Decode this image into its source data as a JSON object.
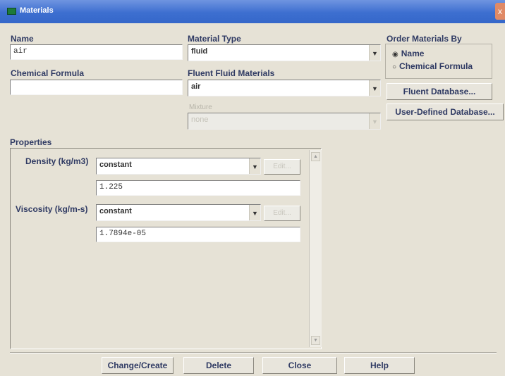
{
  "window": {
    "title": "Materials",
    "close_glyph": "x"
  },
  "name": {
    "label": "Name",
    "value": "air"
  },
  "chemical_formula": {
    "label": "Chemical Formula",
    "value": ""
  },
  "material_type": {
    "label": "Material Type",
    "selected": "fluid"
  },
  "fluent_fluid_materials": {
    "label": "Fluent Fluid Materials",
    "selected": "air"
  },
  "mixture": {
    "label": "Mixture",
    "selected": "none",
    "enabled": false
  },
  "order_by": {
    "label": "Order Materials By",
    "options": [
      {
        "label": "Name",
        "selected": true
      },
      {
        "label": "Chemical Formula",
        "selected": false
      }
    ]
  },
  "buttons": {
    "fluent_database": "Fluent Database...",
    "user_defined_database": "User-Defined Database..."
  },
  "properties": {
    "label": "Properties",
    "density": {
      "label": "Density (kg/m3)",
      "method": "constant",
      "edit_label": "Edit...",
      "value": "1.225"
    },
    "viscosity": {
      "label": "Viscosity (kg/m-s)",
      "method": "constant",
      "edit_label": "Edit...",
      "value": "1.7894e-05"
    }
  },
  "footer": {
    "change_create": "Change/Create",
    "delete": "Delete",
    "close": "Close",
    "help": "Help"
  },
  "icons": {
    "combo_arrow": "▼",
    "radio_selected": "◉",
    "radio_unselected": "○",
    "scroll_up": "▲",
    "scroll_down": "▼"
  },
  "colors": {
    "titlebar": "#3d6fd0",
    "dialog_bg": "#e6e2d6",
    "label_text": "#2f3a63"
  }
}
